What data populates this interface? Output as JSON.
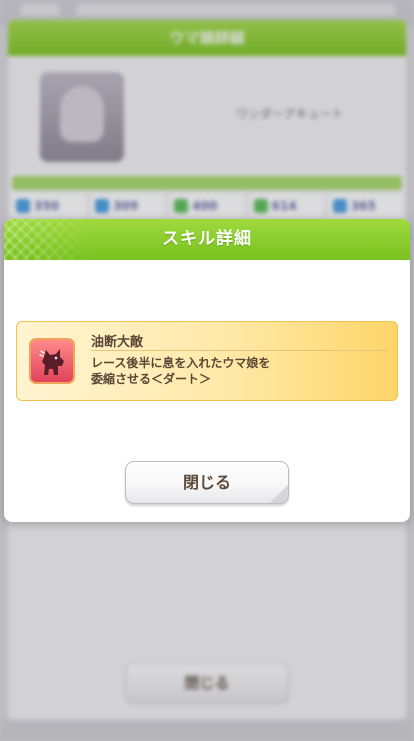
{
  "background": {
    "title": "ウマ娘詳細",
    "character_name": "ワンダーアキュート",
    "stats": [
      "350",
      "309",
      "400",
      "614",
      "365"
    ],
    "close_label": "閉じる"
  },
  "dialog": {
    "title": "スキル詳細",
    "skill": {
      "name": "油断大敵",
      "description_line1": "レース後半に息を入れたウマ娘を",
      "description_line2": "委縮させる＜ダート＞",
      "icon": "debuff-horse-icon"
    },
    "close_label": "閉じる"
  },
  "colors": {
    "header_green": "#7cc520",
    "card_gold": "#ffd56a",
    "icon_red": "#e0425a",
    "text_brown": "#5a4636"
  }
}
